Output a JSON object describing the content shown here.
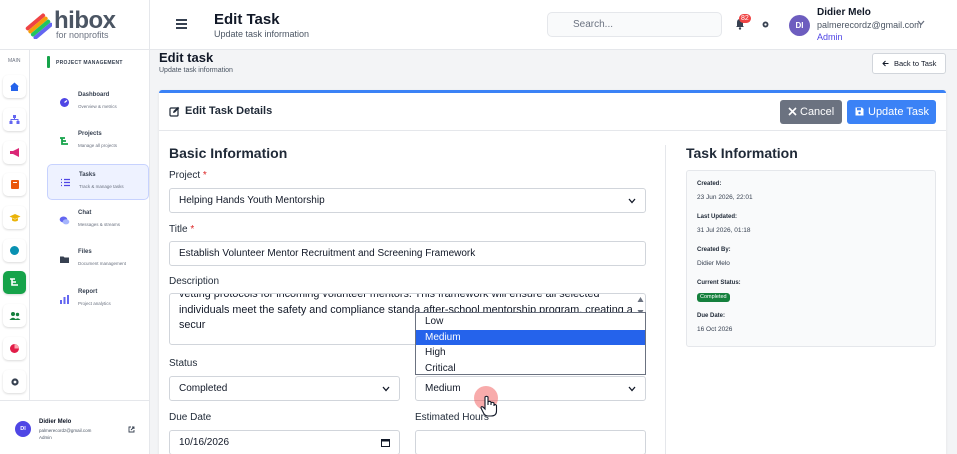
{
  "app": {
    "logo_word": "hibox",
    "logo_sub": "for nonprofits"
  },
  "header": {
    "title": "Edit Task",
    "subtitle": "Update task information",
    "search_placeholder": "Search...",
    "notifications_count": "82",
    "user": {
      "initials": "DI",
      "name": "Didier Melo",
      "email": "palmerecordz@gmail.com",
      "role": "Admin"
    }
  },
  "rail": {
    "label": "MAIN",
    "icons": [
      "home-icon",
      "sitemap-icon",
      "megaphone-icon",
      "book-icon",
      "graduation-cap-icon",
      "globe-icon",
      "project-tree-icon",
      "users-icon",
      "chart-pie-icon",
      "gear-icon"
    ],
    "active_index": 6
  },
  "sidebar": {
    "section": "PROJECT MANAGEMENT",
    "items": [
      {
        "title": "Dashboard",
        "desc": "Overview & metrics",
        "icon": "gauge-icon",
        "color": "#4f46e5"
      },
      {
        "title": "Projects",
        "desc": "Manage all projects",
        "icon": "project-tree-icon",
        "color": "#16a34a"
      },
      {
        "title": "Tasks",
        "desc": "Track & manage tasks",
        "icon": "list-icon",
        "color": "#4f46e5"
      },
      {
        "title": "Chat",
        "desc": "Messages & streams",
        "icon": "chat-icon",
        "color": "#6366f1"
      },
      {
        "title": "Files",
        "desc": "Document management",
        "icon": "folder-icon",
        "color": "#374151"
      },
      {
        "title": "Report",
        "desc": "Project analytics",
        "icon": "bar-chart-icon",
        "color": "#6366f1"
      }
    ],
    "active_index": 2,
    "footer_user": {
      "initials": "DI",
      "name": "Didier Melo",
      "email": "palmerecordz@gmail.com",
      "role": "Admin"
    }
  },
  "page": {
    "title": "Edit task",
    "subtitle": "Update task information",
    "back_label": "Back to Task"
  },
  "card": {
    "title": "Edit Task Details",
    "cancel_label": "Cancel",
    "update_label": "Update Task"
  },
  "form": {
    "section_title": "Basic Information",
    "project_label": "Project",
    "project_value": "Helping Hands Youth Mentorship",
    "title_label": "Title",
    "title_value": "Establish Volunteer Mentor Recruitment and Screening Framework",
    "description_label": "Description",
    "description_value": "vetting protocols for incoming volunteer mentors. This framework will ensure all selected individuals meet the safety and compliance standa after-school mentorship program, creating a secur",
    "status_label": "Status",
    "status_value": "Completed",
    "priority_value": "Medium",
    "priority_options": [
      "Low",
      "Medium",
      "High",
      "Critical"
    ],
    "priority_selected_index": 1,
    "due_date_label": "Due Date",
    "due_date_value": "10/16/2026",
    "hours_label": "Estimated Hours",
    "hours_value": ""
  },
  "task_info": {
    "title": "Task Information",
    "created_label": "Created:",
    "created_value": "23 Jun 2026, 22:01",
    "updated_label": "Last Updated:",
    "updated_value": "31 Jul 2026, 01:18",
    "created_by_label": "Created By:",
    "created_by_value": "Didier Melo",
    "status_label": "Current Status:",
    "status_value": "Completed",
    "due_label": "Due Date:",
    "due_value": "16 Oct 2026"
  },
  "colors": {
    "primary": "#3b82f6",
    "accent_green": "#16a34a",
    "status_green": "#15803d",
    "cancel_gray": "#6b7280",
    "indigo": "#4f46e5"
  }
}
